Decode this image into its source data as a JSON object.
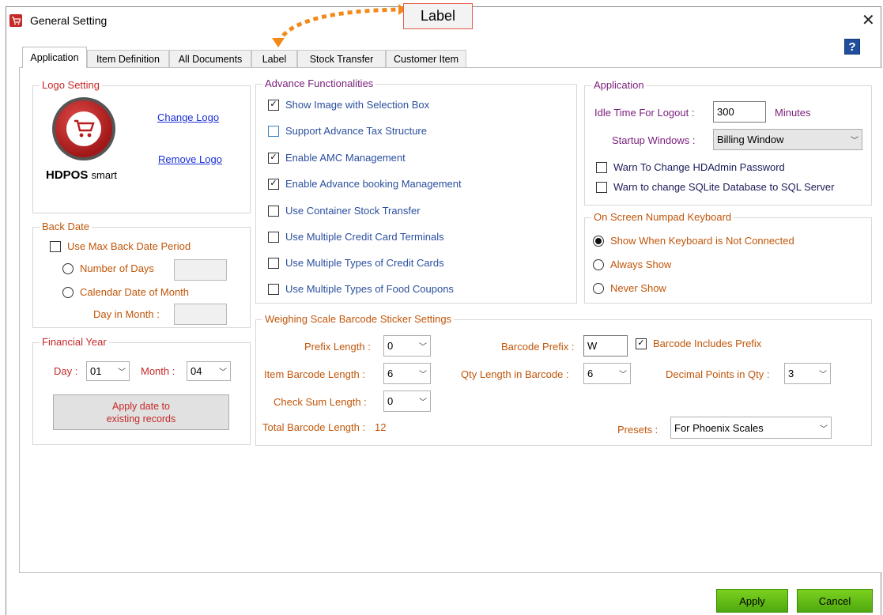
{
  "window": {
    "title": "General Setting",
    "close_symbol": "✕",
    "help_symbol": "?"
  },
  "callout": {
    "text": "Label"
  },
  "tabs": [
    {
      "label": "Application"
    },
    {
      "label": "Item Definition"
    },
    {
      "label": "All Documents"
    },
    {
      "label": "Label"
    },
    {
      "label": "Stock Transfer"
    },
    {
      "label": "Customer Item"
    }
  ],
  "logo_setting": {
    "title": "Logo Setting",
    "change_logo": "Change Logo",
    "remove_logo": "Remove Logo",
    "logo_text_main": "HDPOS",
    "logo_text_sub": "smart"
  },
  "back_date": {
    "title": "Back Date",
    "use_max": {
      "label": "Use Max Back Date Period",
      "checked": false
    },
    "number_of_days": "Number of Days",
    "calendar_date": "Calendar Date of Month",
    "day_in_month": "Day in Month :"
  },
  "financial_year": {
    "title": "Financial Year",
    "day_label": "Day :",
    "day_value": "01",
    "month_label": "Month :",
    "month_value": "04",
    "apply_btn_line1": "Apply date to",
    "apply_btn_line2": "existing records"
  },
  "advance": {
    "title": "Advance Functionalities",
    "items": [
      {
        "label": "Show Image with Selection Box",
        "checked": "✓"
      },
      {
        "label": "Support Advance Tax Structure",
        "checked": ""
      },
      {
        "label": "Enable AMC Management",
        "checked": "✓"
      },
      {
        "label": "Enable Advance booking Management",
        "checked": "✓"
      },
      {
        "label": "Use Container Stock Transfer",
        "checked": ""
      },
      {
        "label": "Use Multiple Credit Card Terminals",
        "checked": ""
      },
      {
        "label": "Use Multiple Types of Credit Cards",
        "checked": ""
      },
      {
        "label": "Use Multiple Types of Food Coupons",
        "checked": ""
      }
    ]
  },
  "application": {
    "title": "Application",
    "idle_label": "Idle Time For Logout :",
    "idle_value": "300",
    "idle_unit": "Minutes",
    "startup_label": "Startup Windows :",
    "startup_value": "Billing Window",
    "warn_hdadmin": "Warn To Change HDAdmin Password",
    "warn_sqlite": "Warn to change SQLite Database to SQL Server"
  },
  "numpad": {
    "title": "On Screen Numpad Keyboard",
    "options": [
      {
        "label": "Show When Keyboard is Not Connected",
        "selected": true
      },
      {
        "label": "Always Show",
        "selected": false
      },
      {
        "label": "Never Show",
        "selected": false
      }
    ]
  },
  "weighing": {
    "title": "Weighing Scale Barcode Sticker Settings",
    "prefix_length_label": "Prefix Length :",
    "prefix_length_value": "0",
    "item_barcode_length_label": "Item Barcode Length :",
    "item_barcode_length_value": "6",
    "check_sum_length_label": "Check Sum Length :",
    "check_sum_length_value": "0",
    "total_label": "Total Barcode Length :",
    "total_value": "12",
    "barcode_prefix_label": "Barcode Prefix :",
    "barcode_prefix_value": "W",
    "includes_prefix_label": "Barcode Includes Prefix",
    "qty_length_label": "Qty Length in Barcode :",
    "qty_length_value": "6",
    "decimal_label": "Decimal Points in Qty :",
    "decimal_value": "3",
    "presets_label": "Presets :",
    "presets_value": "For Phoenix Scales"
  },
  "footer": {
    "apply": "Apply",
    "cancel": "Cancel"
  },
  "colors": {
    "accent_orange": "#c0560a",
    "link_blue": "#1a2fd6",
    "button_green": "#5cb814",
    "group_purple": "#7a1f7a"
  }
}
